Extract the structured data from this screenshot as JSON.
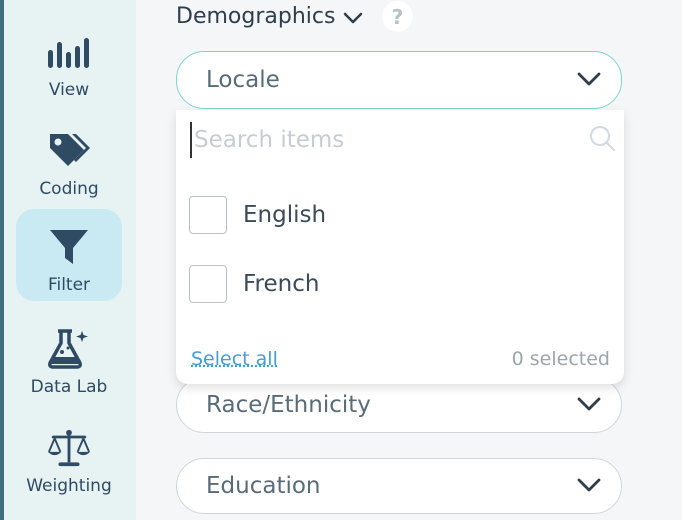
{
  "sidebar": {
    "items": [
      {
        "label": "View",
        "icon": "bar-chart-icon",
        "active": false
      },
      {
        "label": "Coding",
        "icon": "tags-icon",
        "active": false
      },
      {
        "label": "Filter",
        "icon": "filter-icon",
        "active": true
      },
      {
        "label": "Data Lab",
        "icon": "flask-icon",
        "active": false
      },
      {
        "label": "Weighting",
        "icon": "scale-icon",
        "active": false
      }
    ]
  },
  "section": {
    "title": "Demographics",
    "help": "?"
  },
  "locale": {
    "label": "Locale",
    "search_placeholder": "Search items",
    "options": [
      "English",
      "French"
    ],
    "select_all": "Select all",
    "selected_count": "0 selected"
  },
  "filters": [
    "Race/Ethnicity",
    "Education"
  ],
  "colors": {
    "sidebar_bg": "#e7f2f3",
    "active_bg": "#c9eaf2",
    "icon": "#2f4b63",
    "link": "#3f9fd6",
    "focus_border": "#7fd2ce"
  }
}
